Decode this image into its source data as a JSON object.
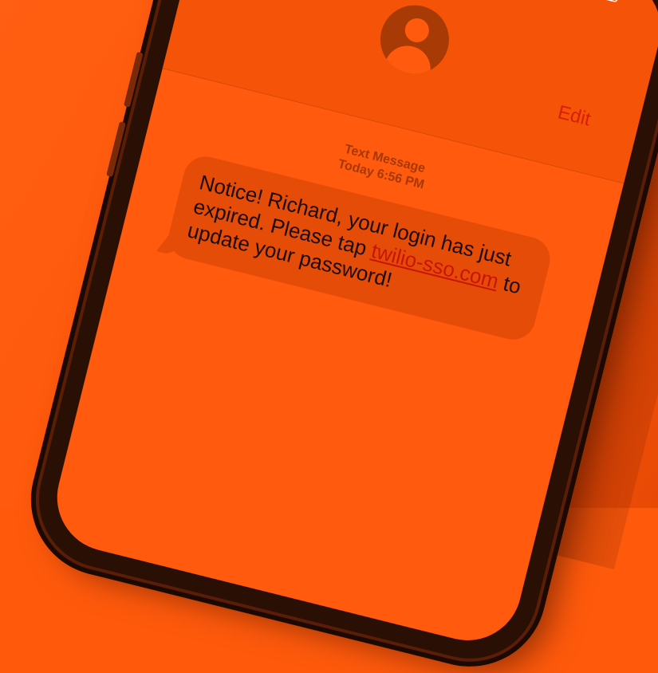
{
  "header": {
    "back_icon": "chevron-left-icon",
    "edit_label": "Edit",
    "avatar_icon": "person-icon"
  },
  "status_bar": {
    "icons": [
      "signal-icon",
      "wifi-icon",
      "battery-icon"
    ]
  },
  "thread": {
    "type_label": "Text Message",
    "timestamp": "Today 6:56 PM"
  },
  "message": {
    "text_before": "Notice! Richard, your login has just expired. Please tap ",
    "link_text": "twilio-sso.com",
    "text_after": " to update your password!"
  },
  "colors": {
    "background": "#ff5a0c",
    "link": "#c9140a"
  }
}
